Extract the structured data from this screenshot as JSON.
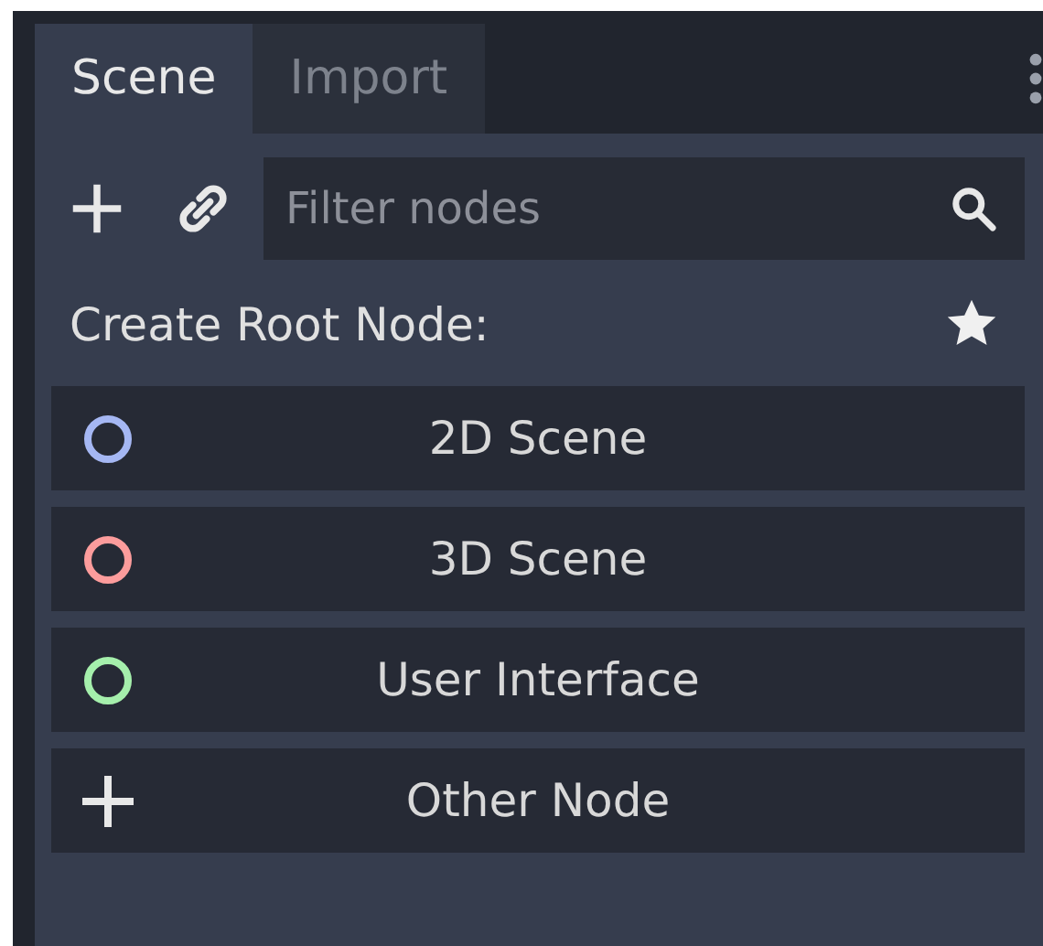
{
  "tabs": [
    {
      "label": "Scene",
      "selected": true
    },
    {
      "label": "Import",
      "selected": false
    }
  ],
  "toolbar": {
    "filter": {
      "placeholder": "Filter nodes"
    }
  },
  "create_root": {
    "label": "Create Root Node:"
  },
  "root_options": [
    {
      "kind": "circle",
      "color": "#a5b7f3",
      "label": "2D Scene"
    },
    {
      "kind": "circle",
      "color": "#fc9c9c",
      "label": "3D Scene"
    },
    {
      "kind": "circle",
      "color": "#a5efac",
      "label": "User Interface"
    },
    {
      "kind": "plus",
      "label": "Other Node"
    }
  ]
}
